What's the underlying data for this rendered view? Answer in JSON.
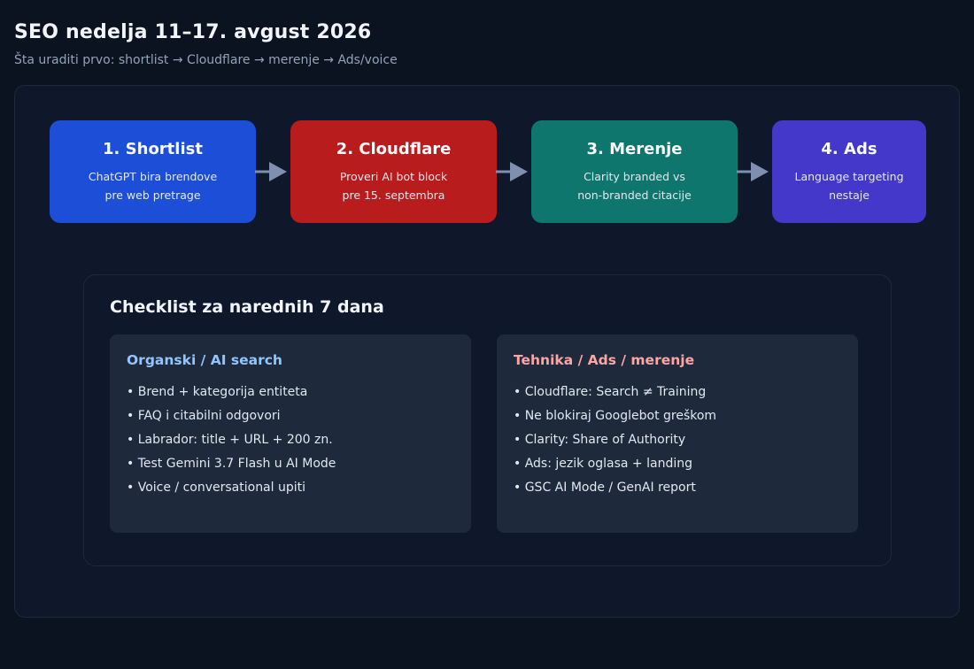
{
  "header": {
    "title": "SEO nedelja 11–17. avgust 2026",
    "subtitle": "Šta uraditi prvo: shortlist → Cloudflare → merenje → Ads/voice"
  },
  "steps": [
    {
      "title": "1. Shortlist",
      "line1": "ChatGPT bira brendove",
      "line2": "pre web pretrage",
      "color": "#1d4ed8"
    },
    {
      "title": "2. Cloudflare",
      "line1": "Proveri AI bot block",
      "line2": "pre 15. septembra",
      "color": "#b91c1c"
    },
    {
      "title": "3. Merenje",
      "line1": "Clarity branded vs",
      "line2": "non-branded citacije",
      "color": "#0f766e"
    },
    {
      "title": "4. Ads",
      "line1": "Language targeting",
      "line2": "nestaje",
      "color": "#4338ca"
    }
  ],
  "checklist": {
    "title": "Checklist za narednih 7 dana",
    "columns": [
      {
        "heading": "Organski / AI search",
        "heading_color": "#93c5fd",
        "items": [
          "• Brend + kategorija entiteta",
          "• FAQ i citabilni odgovori",
          "• Labrador: title + URL + 200 zn.",
          "• Test Gemini 3.7 Flash u AI Mode",
          "• Voice / conversational upiti"
        ]
      },
      {
        "heading": "Tehnika / Ads / merenje",
        "heading_color": "#fca5a5",
        "items": [
          "• Cloudflare: Search ≠ Training",
          "• Ne blokiraj Googlebot greškom",
          "• Clarity: Share of Authority",
          "• Ads: jezik oglasa + landing",
          "• GSC AI Mode / GenAI report"
        ]
      }
    ]
  }
}
